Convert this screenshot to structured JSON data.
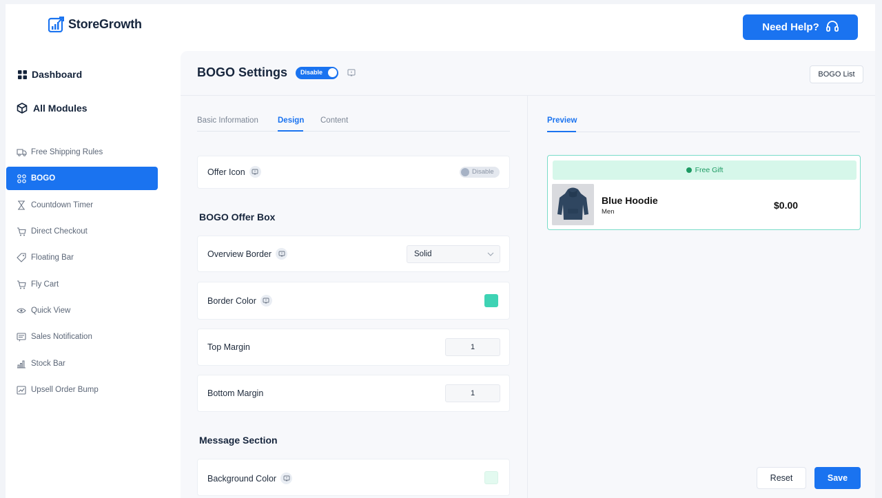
{
  "brand": {
    "name": "StoreGrowth"
  },
  "header": {
    "help_label": "Need Help?"
  },
  "sidebar": {
    "dashboard": "Dashboard",
    "all_modules": "All Modules",
    "items": [
      {
        "label": "Free Shipping Rules",
        "icon": "truck-icon"
      },
      {
        "label": "BOGO",
        "icon": "grid-icon",
        "active": true
      },
      {
        "label": "Countdown Timer",
        "icon": "hourglass-icon"
      },
      {
        "label": "Direct Checkout",
        "icon": "cart-icon"
      },
      {
        "label": "Floating Bar",
        "icon": "tag-icon"
      },
      {
        "label": "Fly Cart",
        "icon": "cart-icon"
      },
      {
        "label": "Quick View",
        "icon": "eye-icon"
      },
      {
        "label": "Sales Notification",
        "icon": "notification-icon"
      },
      {
        "label": "Stock Bar",
        "icon": "bar-chart-icon"
      },
      {
        "label": "Upsell Order Bump",
        "icon": "trend-icon"
      }
    ]
  },
  "page": {
    "title": "BOGO Settings",
    "status_toggle": "Disable",
    "bogo_list_label": "BOGO List"
  },
  "tabs": {
    "basic": "Basic Information",
    "design": "Design",
    "content": "Content"
  },
  "form": {
    "offer_icon": {
      "label": "Offer Icon",
      "toggle": "Disable"
    },
    "section_offer_box": "BOGO Offer Box",
    "overview_border": {
      "label": "Overview Border",
      "value": "Solid"
    },
    "border_color": {
      "label": "Border Color",
      "color": "#3ed3b4"
    },
    "top_margin": {
      "label": "Top Margin",
      "value": "1"
    },
    "bottom_margin": {
      "label": "Bottom Margin",
      "value": "1"
    },
    "section_message": "Message Section",
    "background_color": {
      "label": "Background Color",
      "color": "#e3faf0"
    }
  },
  "preview": {
    "tab": "Preview",
    "badge": "Free Gift",
    "product_name": "Blue Hoodie",
    "product_category": "Men",
    "price": "$0.00"
  },
  "actions": {
    "reset": "Reset",
    "save": "Save"
  },
  "colors": {
    "accent": "#1a73f0",
    "preview_border": "#78dcc8",
    "gift_bg": "#d6f7ea",
    "gift_text": "#1d9a63"
  }
}
